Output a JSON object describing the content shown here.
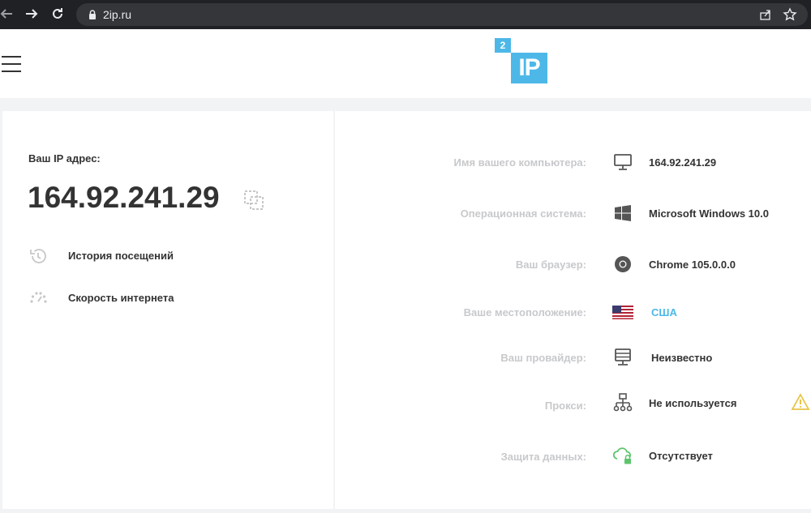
{
  "browser": {
    "url": "2ip.ru",
    "icons": [
      "back-arrow-icon",
      "forward-arrow-icon",
      "reload-icon",
      "lock-icon",
      "share-icon",
      "star-icon"
    ]
  },
  "header": {
    "logo_small": "2",
    "logo_main": "IP",
    "brand_color": "#4db8e8"
  },
  "ip_card": {
    "label": "Ваш IP адрес:",
    "ip": "164.92.241.29",
    "links": [
      {
        "label": "История посещений",
        "icon": "history-icon"
      },
      {
        "label": "Скорость интернета",
        "icon": "speedometer-icon"
      }
    ]
  },
  "info": {
    "rows": [
      {
        "label": "Имя вашего компьютера:",
        "value": "164.92.241.29",
        "icon": "monitor-icon"
      },
      {
        "label": "Операционная система:",
        "value": "Microsoft Windows 10.0",
        "icon": "windows-icon"
      },
      {
        "label": "Ваш браузер:",
        "value": "Chrome 105.0.0.0",
        "icon": "chrome-icon"
      },
      {
        "label": "Ваше местоположение:",
        "value": "США",
        "icon": "us-flag-icon"
      },
      {
        "label": "Ваш провайдер:",
        "value": "Неизвестно",
        "icon": "server-icon"
      },
      {
        "label": "Прокси:",
        "value": "Не используется",
        "icon": "network-icon"
      },
      {
        "label": "Защита данных:",
        "value": "Отсутствует",
        "icon": "cloud-lock-icon"
      }
    ]
  }
}
